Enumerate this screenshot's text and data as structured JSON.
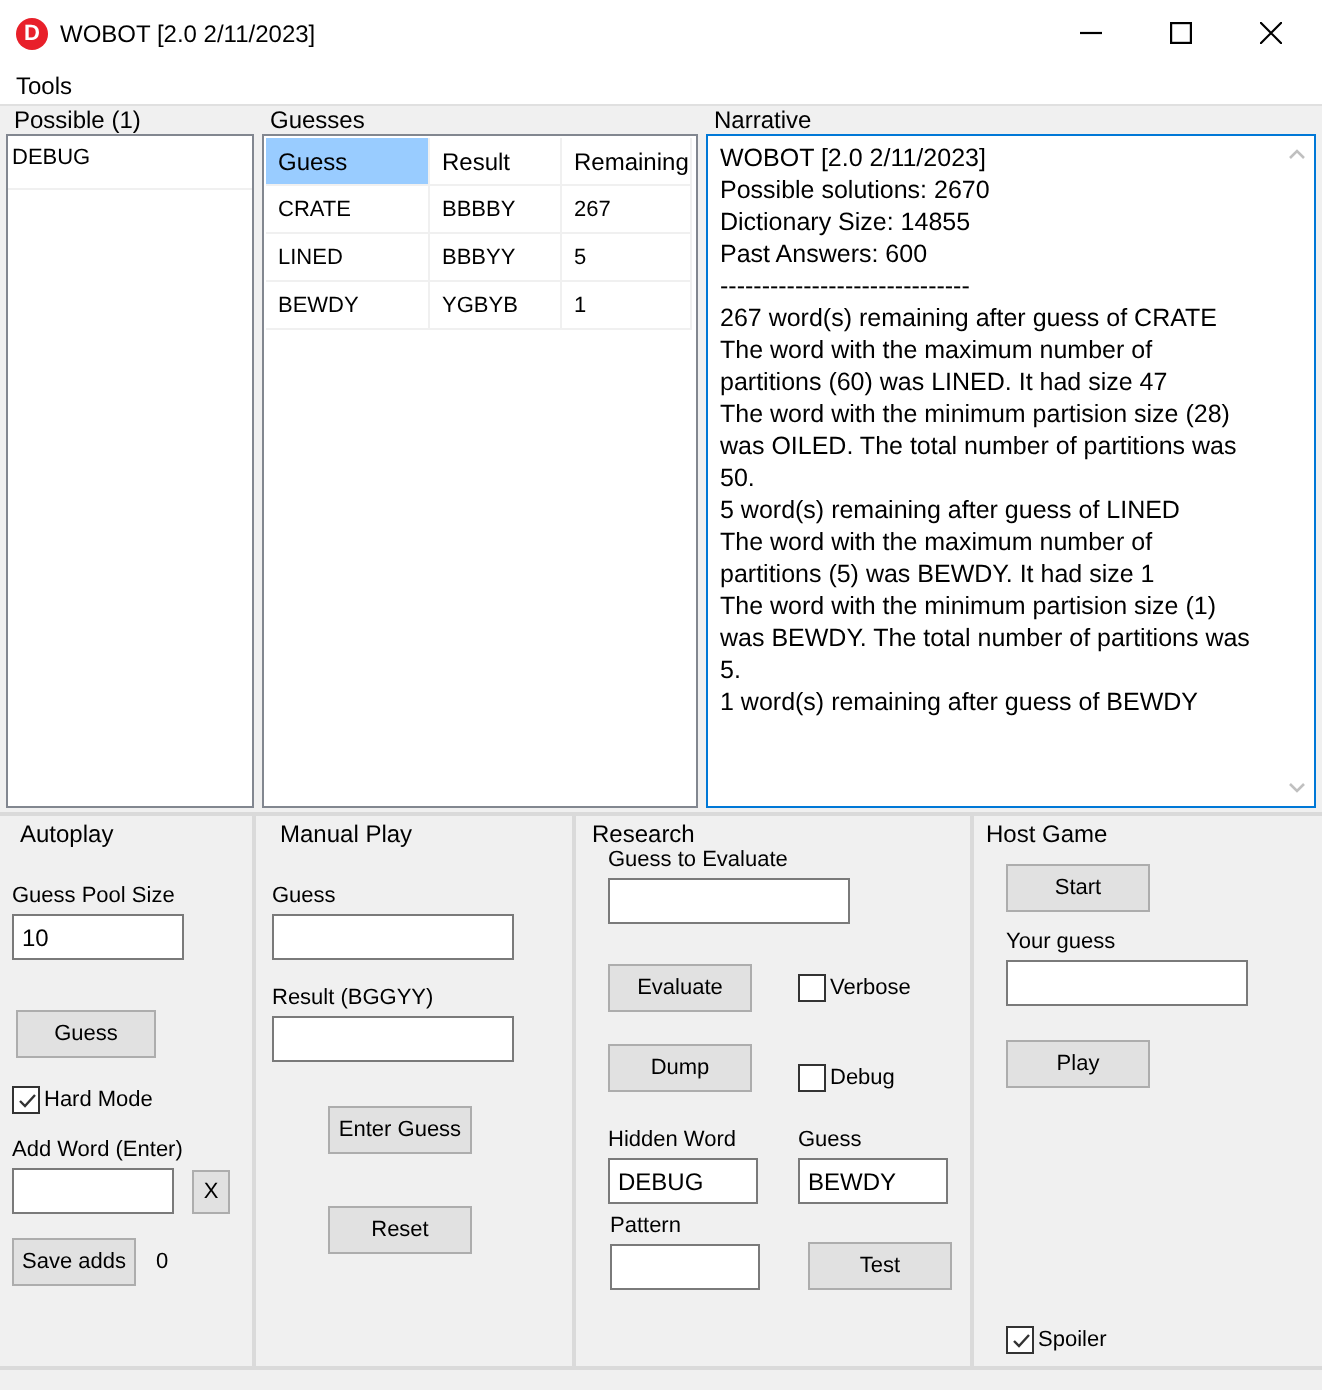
{
  "window": {
    "title": "WOBOT [2.0 2/11/2023]",
    "icon_letter": "D"
  },
  "menu": [
    "Tools"
  ],
  "possible": {
    "title": "Possible (1)",
    "items": [
      "DEBUG"
    ]
  },
  "guesses": {
    "title": "Guesses",
    "columns": [
      {
        "label": "Guess",
        "selected": true
      },
      {
        "label": "Result",
        "selected": false
      },
      {
        "label": "Remaining",
        "selected": false
      }
    ],
    "rows": [
      [
        "CRATE",
        "BBBBY",
        "267"
      ],
      [
        "LINED",
        "BBBYY",
        "5"
      ],
      [
        "BEWDY",
        "YGBYB",
        "1"
      ]
    ]
  },
  "narrative": {
    "title": "Narrative",
    "lines": [
      "WOBOT [2.0 2/11/2023]",
      "Possible solutions: 2670",
      "Dictionary Size: 14855",
      "Past Answers: 600",
      "------------------------------",
      "267 word(s) remaining after guess of CRATE",
      "The word with the maximum number of partitions (60) was LINED. It had size 47",
      "The word with the minimum partision size (28) was OILED. The total number of partitions was 50.",
      "5 word(s) remaining after guess of LINED",
      "The word with the maximum number of partitions (5) was BEWDY. It had size 1",
      "The word with the minimum partision size (1) was BEWDY. The total number of partitions was 5.",
      "1 word(s) remaining after guess of BEWDY"
    ]
  },
  "autoplay": {
    "title": "Autoplay",
    "pool_label": "Guess Pool Size",
    "pool_value": "10",
    "guess_button": "Guess",
    "hard_mode": {
      "label": "Hard Mode",
      "checked": true
    },
    "add_label": "Add Word (Enter)",
    "clear_button": "X",
    "save_button": "Save adds",
    "adds_count": "0"
  },
  "manual": {
    "title": "Manual Play",
    "guess_label": "Guess",
    "result_label": "Result (BGGYY)",
    "enter_button": "Enter Guess",
    "reset_button": "Reset"
  },
  "research": {
    "title": "Research",
    "evaluate_label": "Guess to Evaluate",
    "evaluate_button": "Evaluate",
    "verbose": {
      "label": "Verbose",
      "checked": false
    },
    "dump_button": "Dump",
    "debug": {
      "label": "Debug",
      "checked": false
    },
    "hidden_label": "Hidden Word",
    "hidden_value": "DEBUG",
    "guess_label": "Guess",
    "guess_value": "BEWDY",
    "pattern_label": "Pattern",
    "test_button": "Test"
  },
  "host": {
    "title": "Host Game",
    "start_button": "Start",
    "guess_label": "Your guess",
    "play_button": "Play",
    "spoiler": {
      "label": "Spoiler",
      "checked": true
    }
  }
}
